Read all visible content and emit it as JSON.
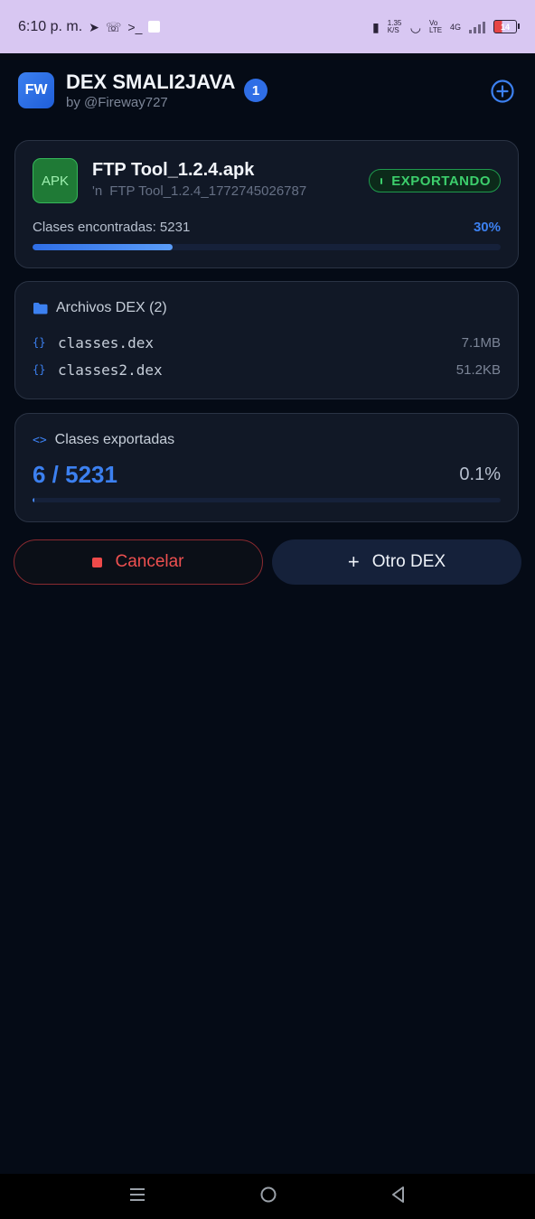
{
  "status_bar": {
    "time": "6:10 p. m.",
    "net_speed": "1.35 K/S",
    "volte": "Vo LTE",
    "network": "4G",
    "battery": "14"
  },
  "header": {
    "logo_text": "FW",
    "title": "DEX SMALI2JAVA",
    "subtitle": "by @Fireway727",
    "badge_count": "1"
  },
  "apk_card": {
    "icon_label": "APK",
    "file_name": "FTP Tool_1.2.4.apk",
    "path_glyph": "'n",
    "path_text": "FTP Tool_1.2.4_1772745026787",
    "status": "EXPORTANDO",
    "progress_label": "Clases encontradas: 5231",
    "progress_percent": "30%",
    "progress_value": 0.3
  },
  "dex_card": {
    "title": "Archivos DEX (2)",
    "files": [
      {
        "glyph": "{}",
        "name": "classes.dex",
        "size": "7.1MB"
      },
      {
        "glyph": "{}",
        "name": "classes2.dex",
        "size": "51.2KB"
      }
    ]
  },
  "export_card": {
    "glyph": "<>",
    "title": "Clases exportadas",
    "count": "6 / 5231",
    "percent": "0.1%",
    "progress_value": 0.001
  },
  "actions": {
    "cancel_label": "Cancelar",
    "other_plus": "+",
    "other_label": "Otro DEX"
  },
  "colors": {
    "accent": "#3c80f0",
    "success": "#3ccf6c",
    "danger": "#ee5050",
    "background": "#050b16"
  }
}
